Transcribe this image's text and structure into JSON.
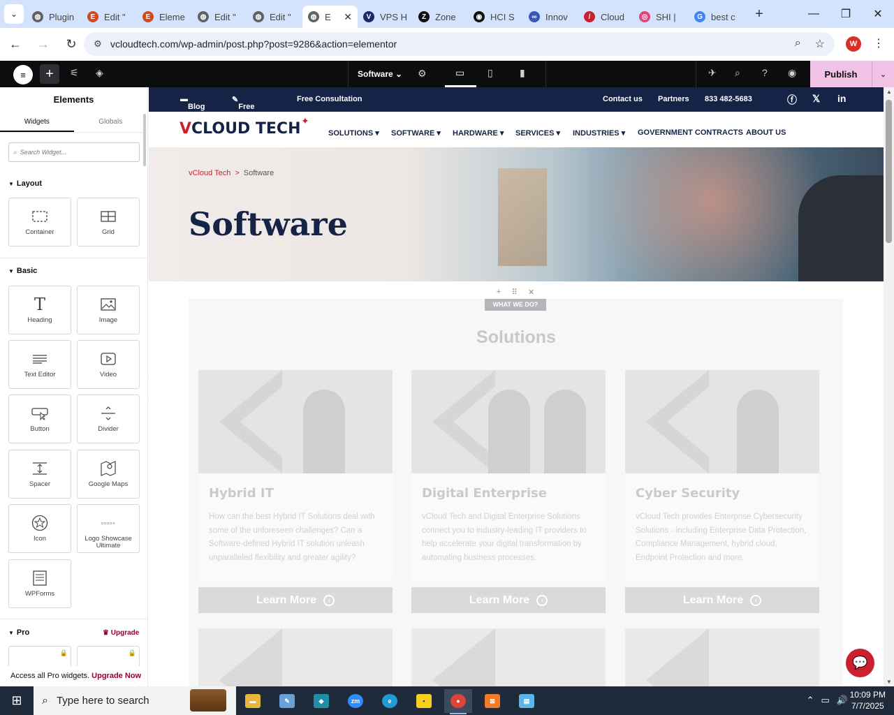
{
  "browser": {
    "tabs": [
      {
        "label": "Plugin",
        "color": "#5f6368",
        "glyph": "◍"
      },
      {
        "label": "Edit \"",
        "color": "#d24b20",
        "glyph": "E"
      },
      {
        "label": "Eleme",
        "color": "#d24b20",
        "glyph": "E"
      },
      {
        "label": "Edit \"",
        "color": "#5f6368",
        "glyph": "◍"
      },
      {
        "label": "Edit \"",
        "color": "#5f6368",
        "glyph": "◍"
      },
      {
        "label": "E",
        "color": "#5f6368",
        "glyph": "◍"
      },
      {
        "label": "VPS H",
        "color": "#1a2a6c",
        "glyph": "V"
      },
      {
        "label": "Zone",
        "color": "#111111",
        "glyph": "Z"
      },
      {
        "label": "HCI S",
        "color": "#111111",
        "glyph": "◉"
      },
      {
        "label": "Innov",
        "color": "#3a57b5",
        "glyph": "∞"
      },
      {
        "label": "Cloud",
        "color": "#cc1f2f",
        "glyph": "/"
      },
      {
        "label": "SHI |",
        "color": "#e0447a",
        "glyph": "◎"
      },
      {
        "label": "best c",
        "color": "#4285f4",
        "glyph": "G"
      }
    ],
    "url": "vcloudtech.com/wp-admin/post.php?post=9286&action=elementor",
    "profile_initial": "W"
  },
  "editor": {
    "page_name": "Software",
    "publish_label": "Publish"
  },
  "panel": {
    "title": "Elements",
    "tabs": [
      "Widgets",
      "Globals"
    ],
    "search_placeholder": "Search Widget...",
    "categories": {
      "layout": "Layout",
      "basic": "Basic",
      "pro": "Pro"
    },
    "upgrade_label": "Upgrade",
    "widgets": {
      "container": "Container",
      "grid": "Grid",
      "heading": "Heading",
      "image": "Image",
      "text_editor": "Text Editor",
      "video": "Video",
      "button": "Button",
      "divider": "Divider",
      "spacer": "Spacer",
      "google_maps": "Google Maps",
      "icon": "Icon",
      "logo_showcase": "Logo Showcase Ultimate",
      "wpforms": "WPForms"
    },
    "pro_notice": "Access all Pro widgets.",
    "pro_link": "Upgrade Now"
  },
  "site": {
    "top_left": {
      "blog": "Blog",
      "free_tools": "Free Tools",
      "consultation": "Free Consultation"
    },
    "top_right": {
      "contact": "Contact us",
      "partners": "Partners",
      "phone": "833 482-5683"
    },
    "logo": "CLOUD TECH",
    "nav": {
      "solutions": "SOLUTIONS",
      "software": "SOFTWARE",
      "hardware": "HARDWARE",
      "services": "SERVICES",
      "industries": "INDUSTRIES",
      "government": "GOVERNMENT CONTRACTS",
      "about": "ABOUT US"
    },
    "breadcrumb": {
      "home": "vCloud Tech",
      "sep": ">",
      "current": "Software"
    },
    "hero_title": "Software",
    "section_tag": "WHAT WE DO?",
    "section_heading": "Solutions",
    "cards": [
      {
        "title": "Hybrid IT",
        "text": "How can the best Hybrid IT Solutions deal with some of the unforeseen challenges? Can a Software-defined Hybrid IT solution unleash unparalleled flexibility and greater agility?",
        "button": "Learn More"
      },
      {
        "title": "Digital Enterprise",
        "text": "vCloud Tech and Digital Enterprise Solutions connect you to industry-leading IT providers to help accelerate your digital transformation by automating business processes.",
        "button": "Learn More"
      },
      {
        "title": "Cyber Security",
        "text": "vCloud Tech provides Enterprise Cybersecurity Solutions - including Enterprise Data Protection, Compliance Management, hybrid cloud, Endpoint Protection and more.",
        "button": "Learn More"
      }
    ]
  },
  "taskbar": {
    "search_text": "Type here to search",
    "time": "10:09 PM",
    "date": "7/7/2025"
  }
}
